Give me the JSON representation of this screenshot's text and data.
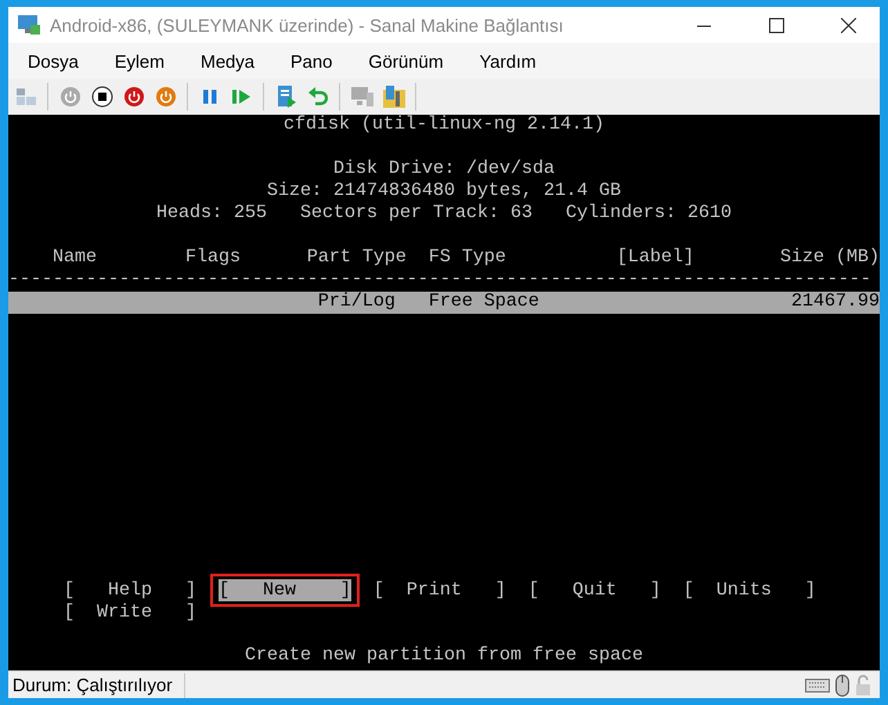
{
  "window": {
    "title": "Android-x86, (SULEYMANK üzerinde) - Sanal Makine Bağlantısı"
  },
  "menu": [
    "Dosya",
    "Eylem",
    "Medya",
    "Pano",
    "Görünüm",
    "Yardım"
  ],
  "terminal": {
    "title": "cfdisk (util-linux-ng 2.14.1)",
    "disk_info": [
      "Disk Drive: /dev/sda",
      "Size: 21474836480 bytes, 21.4 GB",
      "Heads: 255   Sectors per Track: 63   Cylinders: 2610"
    ],
    "columns": [
      "Name",
      "Flags",
      "Part Type",
      "FS Type",
      "[Label]",
      "Size (MB)"
    ],
    "rule": "------------------------------------------------------------------------------",
    "rows": [
      {
        "part_type": "Pri/Log",
        "fs_type": "Free Space",
        "size": "21467.99",
        "selected": true
      }
    ],
    "commands": [
      {
        "label": "[   Help   ]",
        "selected": false
      },
      {
        "label": "[   New    ]",
        "selected": true
      },
      {
        "label": "[  Print   ]",
        "selected": false
      },
      {
        "label": "[   Quit   ]",
        "selected": false
      },
      {
        "label": "[  Units   ]",
        "selected": false
      },
      {
        "label": "[  Write   ]",
        "selected": false
      }
    ],
    "message": "Create new partition from free space"
  },
  "status_bar": {
    "status": "Durum: Çalıştırılıyor"
  }
}
